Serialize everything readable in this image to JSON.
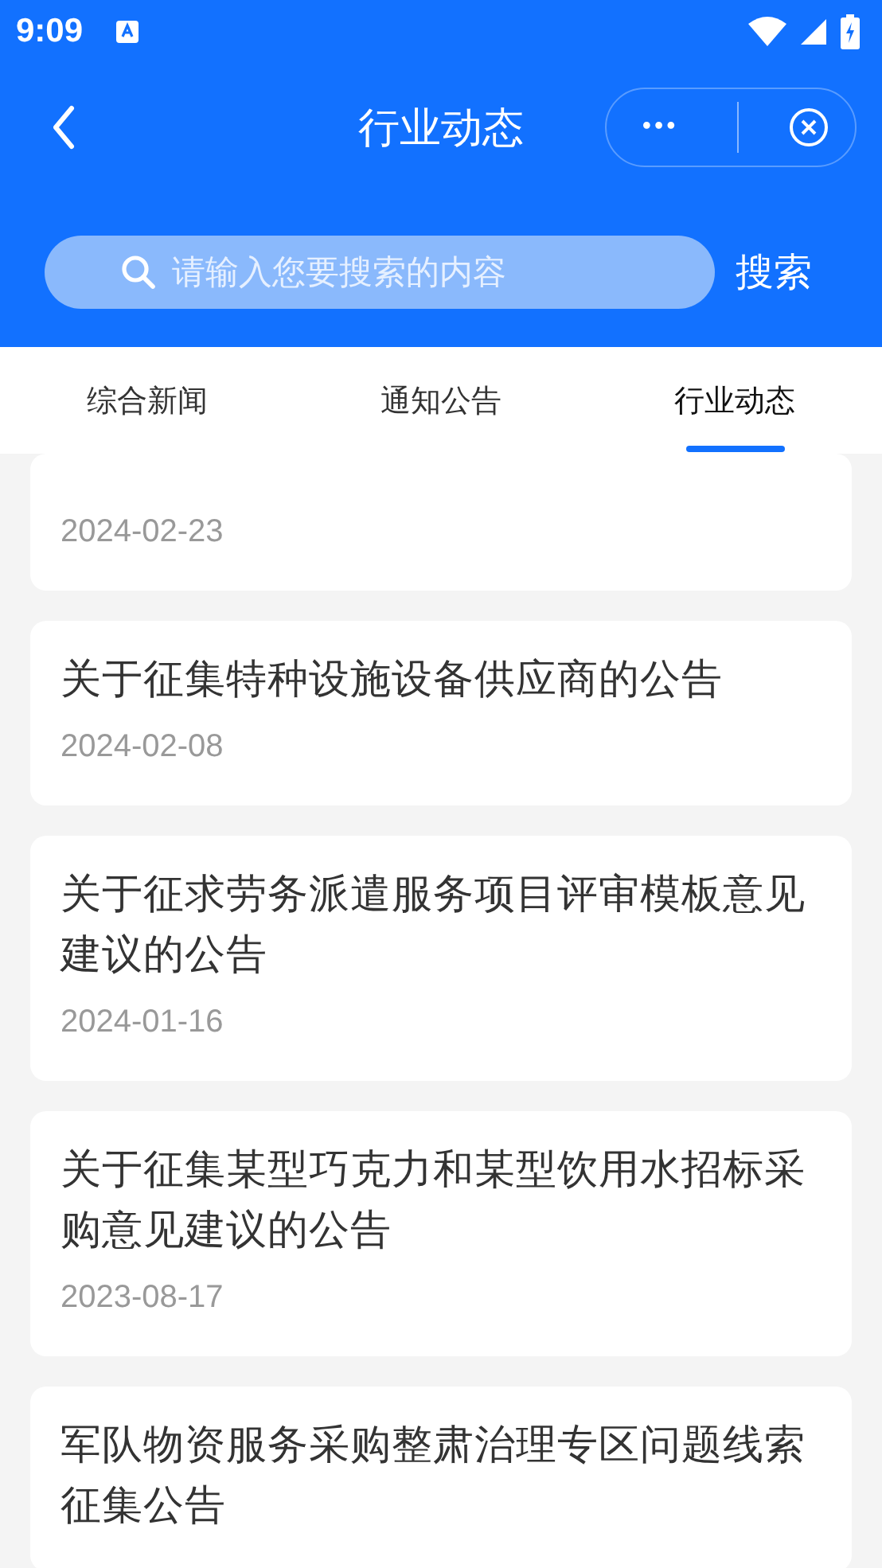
{
  "status_bar": {
    "time": "9:09"
  },
  "nav": {
    "title": "行业动态",
    "more": "•••"
  },
  "search": {
    "placeholder": "请输入您要搜索的内容",
    "button": "搜索"
  },
  "tabs": [
    {
      "label": "综合新闻",
      "selected": false
    },
    {
      "label": "通知公告",
      "selected": false
    },
    {
      "label": "行业动态",
      "selected": true
    }
  ],
  "articles": [
    {
      "date": "2024-02-23"
    },
    {
      "title": "关于征集特种设施设备供应商的公告",
      "date": "2024-02-08"
    },
    {
      "title": "关于征求劳务派遣服务项目评审模板意见建议的公告",
      "date": "2024-01-16"
    },
    {
      "title": "关于征集某型巧克力和某型饮用水招标采购意见建议的公告",
      "date": "2023-08-17"
    },
    {
      "title": "军队物资服务采购整肃治理专区问题线索征集公告"
    }
  ]
}
